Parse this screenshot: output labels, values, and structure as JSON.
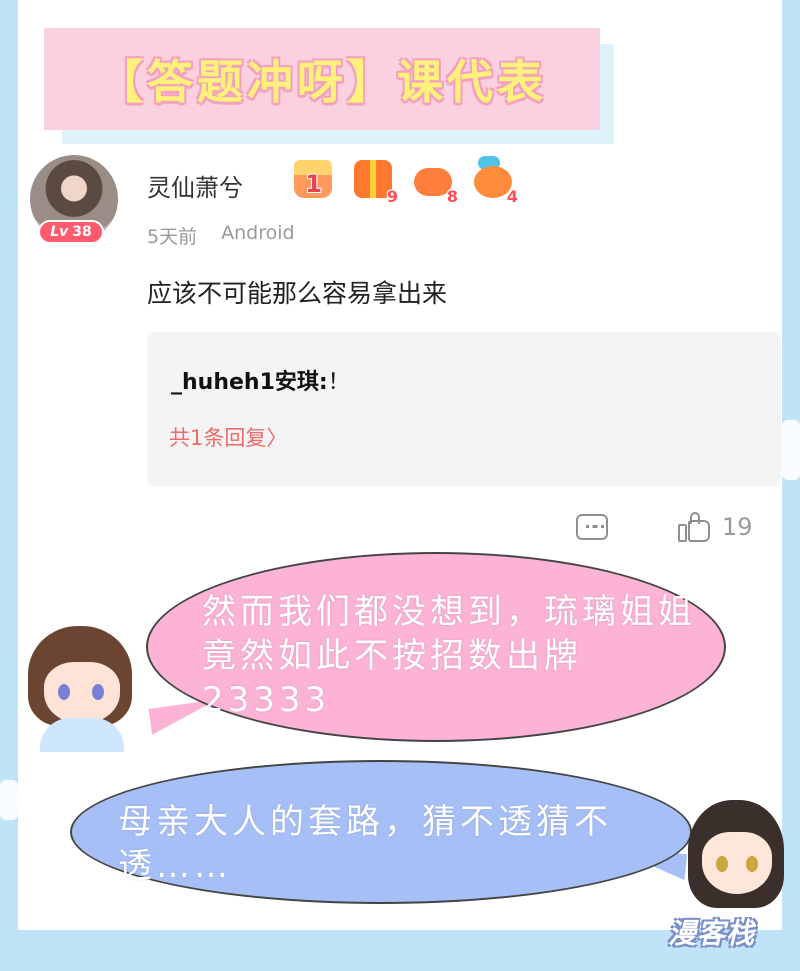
{
  "banner": {
    "title": "【答题冲呀】课代表"
  },
  "comment": {
    "username": "灵仙萧兮",
    "level_prefix": "Lv",
    "level": "38",
    "medals": [
      {
        "icon": "birthday-cake-medal-icon",
        "count": "1"
      },
      {
        "icon": "gift-box-medal-icon",
        "count": "9"
      },
      {
        "icon": "gamepad-medal-icon",
        "count": "8"
      },
      {
        "icon": "chat-bubble-medal-icon",
        "count": "4"
      }
    ],
    "time": "5天前",
    "platform": "Android",
    "text": "应该不可能那么容易拿出来",
    "reply": {
      "author": "_huheh1安琪",
      "separator": ":",
      "text": "！",
      "more_label": "共1条回复",
      "more_chevron": "〉"
    },
    "actions": {
      "comment_icon": "comment-icon",
      "like_icon": "thumbs-up-icon",
      "like_count": "19"
    }
  },
  "dialogue": {
    "pink_bubble": "然而我们都没想到，琉璃姐姐竟然如此不按招数出牌23333",
    "blue_bubble": "母亲大人的套路，猜不透猜不透……"
  },
  "watermark": {
    "text": "漫客栈"
  },
  "colors": {
    "banner_bg": "#fbd0df",
    "banner_text": "#fff27a",
    "level_badge": "#ff5a6e",
    "reply_link": "#f06a6a",
    "pink_bubble": "#fcb3d5",
    "blue_bubble": "#a7bff7",
    "page_bg": "#bfe3f7"
  }
}
